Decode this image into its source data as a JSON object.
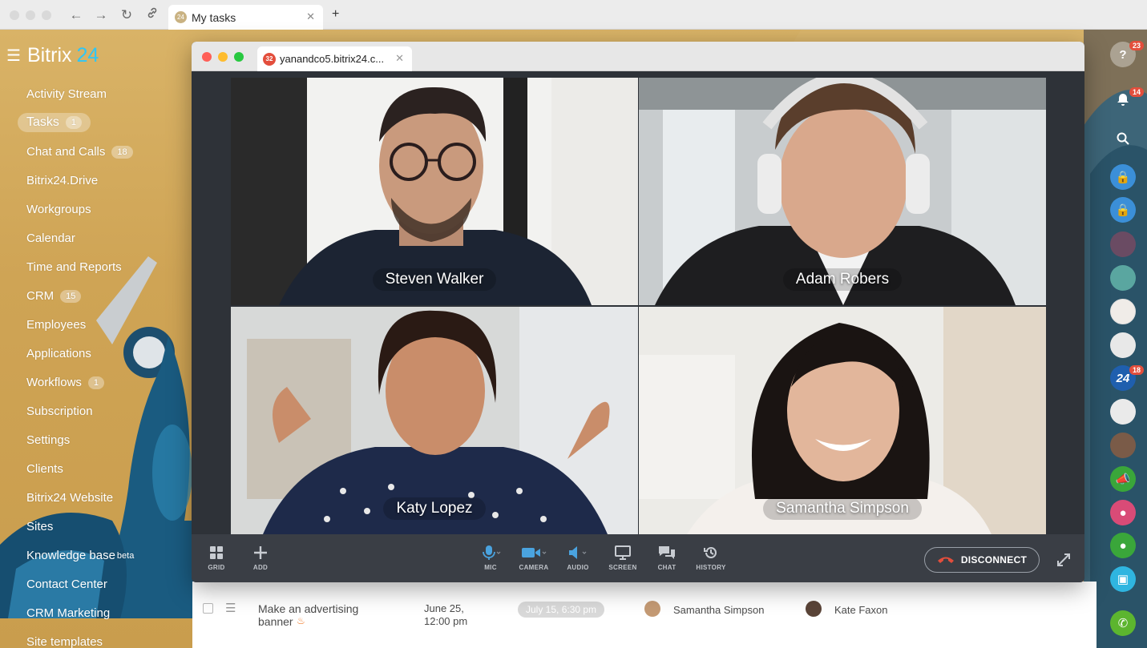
{
  "outer_browser": {
    "tab_title": "My tasks",
    "tab_favicon": "24",
    "new_tab": "+"
  },
  "sidebar": {
    "logo_main": "Bitrix",
    "logo_num": "24",
    "items": [
      {
        "label": "Activity Stream",
        "badge": ""
      },
      {
        "label": "Tasks",
        "badge": "1",
        "active": true
      },
      {
        "label": "Chat and Calls",
        "badge": "18"
      },
      {
        "label": "Bitrix24.Drive",
        "badge": ""
      },
      {
        "label": "Workgroups",
        "badge": ""
      },
      {
        "label": "Calendar",
        "badge": ""
      },
      {
        "label": "Time and Reports",
        "badge": ""
      },
      {
        "label": "CRM",
        "badge": "15"
      },
      {
        "label": "Employees",
        "badge": ""
      },
      {
        "label": "Applications",
        "badge": ""
      },
      {
        "label": "Workflows",
        "badge": "1"
      },
      {
        "label": "Subscription",
        "badge": ""
      },
      {
        "label": "Settings",
        "badge": ""
      },
      {
        "label": "Clients",
        "badge": ""
      },
      {
        "label": "Bitrix24 Website",
        "badge": ""
      },
      {
        "label": "Sites",
        "badge": ""
      },
      {
        "label": "Knowledge base",
        "badge": "",
        "sup": "beta"
      },
      {
        "label": "Contact Center",
        "badge": ""
      },
      {
        "label": "CRM Marketing",
        "badge": ""
      },
      {
        "label": "Site templates",
        "badge": ""
      }
    ]
  },
  "right_rail": {
    "help_badge": "23",
    "notifications_badge": "14",
    "chat24_badge": "18",
    "chat24_label": "24"
  },
  "call_window": {
    "tab_title": "yanandco5.bitrix24.c...",
    "tab_favicon": "32",
    "participants": [
      "Steven Walker",
      "Adam Robers",
      "Katy Lopez",
      "Samantha Simpson"
    ],
    "controls": {
      "grid": "GRID",
      "add": "ADD",
      "mic": "MIC",
      "camera": "CAMERA",
      "audio": "AUDIO",
      "screen": "SCREEN",
      "chat": "CHAT",
      "history": "HISTORY",
      "disconnect": "DISCONNECT"
    }
  },
  "task_row": {
    "title_line1": "Make an advertising",
    "title_line2": "banner",
    "created_line1": "June 25,",
    "created_line2": "12:00 pm",
    "deadline": "July 15, 6:30 pm",
    "responsible": "Samantha Simpson",
    "creator": "Kate Faxon"
  },
  "colors": {
    "accent": "#2fc6f6",
    "badge_red": "#e34e3c",
    "call_bg": "#2e3238"
  }
}
